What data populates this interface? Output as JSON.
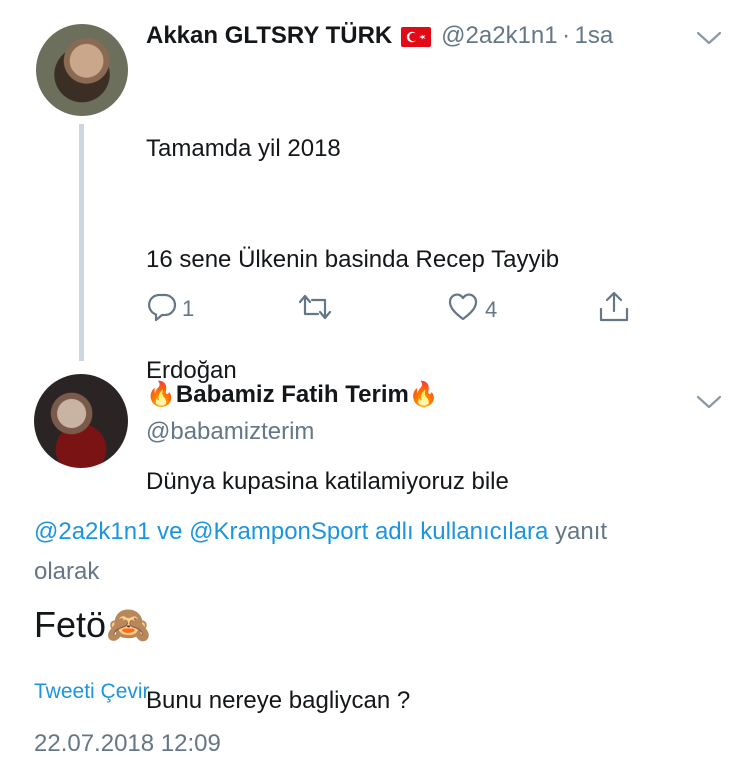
{
  "tweet1": {
    "display_name": "Akkan GLTSRY TÜRK",
    "flag_icon": "turkey-flag",
    "handle": "@2a2k1n1",
    "separator": "·",
    "time": "1sa",
    "lines": [
      "Tamamda yil 2018",
      "16 sene Ülkenin basinda Recep Tayyib",
      "Erdoğan",
      "Dünya kupasina katilamiyoruz bile",
      "Bunu nereye bagliycan ?"
    ],
    "reply_count": "1",
    "like_count": "4"
  },
  "tweet2": {
    "name_prefix_emoji": "🔥",
    "display_name": "Babamiz Fatih Terim",
    "name_suffix_emoji": "🔥",
    "handle": "@babamizterim",
    "reply_to": {
      "mention1": "@2a2k1n1",
      "connector": "ve",
      "mention2": "@KramponSport",
      "suffix_link": "adlı kullanıcılara",
      "suffix_text": "yanıt",
      "line2": "olarak"
    },
    "text": "Fetö",
    "text_emoji": "🙈",
    "translate_label": "Tweeti Çevir",
    "timestamp": "22.07.2018 12:09"
  },
  "icons": {
    "reply": "reply-icon",
    "retweet": "retweet-icon",
    "like": "heart-icon",
    "share": "share-icon",
    "caret": "chevron-down-icon"
  },
  "colors": {
    "link": "#1b95e0",
    "secondary": "#657786",
    "thread_line": "#ccd6dd",
    "flag_red": "#e30a17"
  }
}
